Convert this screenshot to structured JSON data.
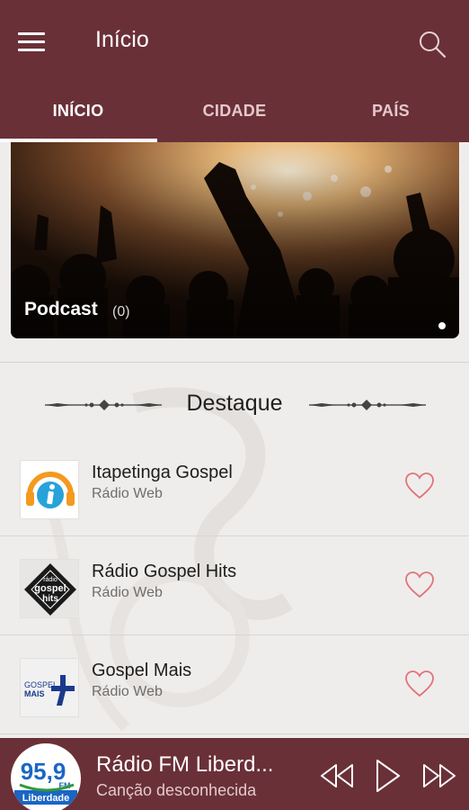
{
  "appbar": {
    "title": "Início",
    "menu_icon": "menu-icon",
    "search_icon": "search-icon",
    "color": "#6a3038"
  },
  "tabs": [
    {
      "label": "INÍCIO",
      "active": true
    },
    {
      "label": "CIDADE",
      "active": false
    },
    {
      "label": "PAÍS",
      "active": false
    }
  ],
  "banner": {
    "title": "Podcast",
    "count": "(0)"
  },
  "featured": {
    "heading": "Destaque",
    "items": [
      {
        "name": "Itapetinga Gospel",
        "type": "Rádio Web",
        "logo": "itapetinga-logo",
        "favorite_icon": "heart-outline-icon"
      },
      {
        "name": "Rádio Gospel Hits",
        "type": "Rádio Web",
        "logo": "gospel-hits-logo",
        "logo_text": [
          "rádio",
          "gospel",
          "hits"
        ],
        "favorite_icon": "heart-outline-icon"
      },
      {
        "name": "Gospel Mais",
        "type": "Rádio Web",
        "logo": "gospel-mais-logo",
        "logo_text": [
          "GOSPEL",
          "MAIS"
        ],
        "favorite_icon": "heart-outline-icon"
      }
    ]
  },
  "player": {
    "station": "Rádio FM Liberd...",
    "song": "Canção desconhecida",
    "logo_text": [
      "95,9",
      "FM",
      "Liberdade"
    ],
    "controls": [
      "rewind-icon",
      "play-icon",
      "fast-forward-icon"
    ]
  },
  "colors": {
    "heart": "#e2727a",
    "accent": "#6a3038"
  }
}
